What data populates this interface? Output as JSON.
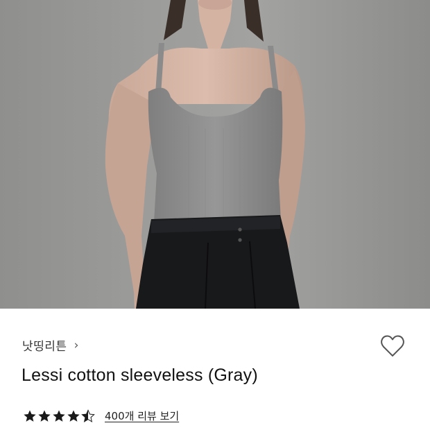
{
  "product": {
    "image_alt": "Model wearing gray ribbed cotton sleeveless top with black trousers",
    "brand": "낫띵리튼",
    "brand_chevron": "›",
    "name": "Lessi cotton sleeveless (Gray)",
    "rating": 4.5,
    "rating_max": 5,
    "review_link": "400개 리뷰 보기"
  },
  "icons": {
    "brand_arrow": "chevron-right-icon",
    "wishlist": "heart-outline-icon",
    "rating": "star-icon"
  },
  "colors": {
    "title": "#111111",
    "star": "#1a1a1a",
    "heart_stroke": "#555555"
  }
}
